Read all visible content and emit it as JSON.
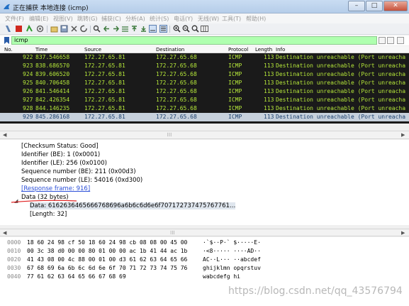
{
  "window": {
    "title": "正在捕获 本地连接 (icmp)",
    "buttons": {
      "minimize": "–",
      "maximize": "□",
      "close": "✕"
    }
  },
  "menu": [
    "文件(F)",
    "编辑(E)",
    "视图(V)",
    "跳转(G)",
    "捕获(C)",
    "分析(A)",
    "统计(S)",
    "电话(Y)",
    "无线(W)",
    "工具(T)",
    "帮助(H)"
  ],
  "filter": {
    "value": "icmp"
  },
  "packet_list": {
    "columns": [
      "No.",
      "Time",
      "Source",
      "Destination",
      "Protocol",
      "Length",
      "Info"
    ],
    "rows": [
      {
        "no": "922",
        "time": "837.546658",
        "src": "172.27.65.81",
        "dst": "172.27.65.68",
        "proto": "ICMP",
        "len": "113",
        "info": "Destination unreachable (Port unreacha"
      },
      {
        "no": "923",
        "time": "838.686570",
        "src": "172.27.65.81",
        "dst": "172.27.65.68",
        "proto": "ICMP",
        "len": "113",
        "info": "Destination unreachable (Port unreacha"
      },
      {
        "no": "924",
        "time": "839.606520",
        "src": "172.27.65.81",
        "dst": "172.27.65.68",
        "proto": "ICMP",
        "len": "113",
        "info": "Destination unreachable (Port unreacha"
      },
      {
        "no": "925",
        "time": "840.706458",
        "src": "172.27.65.81",
        "dst": "172.27.65.68",
        "proto": "ICMP",
        "len": "113",
        "info": "Destination unreachable (Port unreacha"
      },
      {
        "no": "926",
        "time": "841.546414",
        "src": "172.27.65.81",
        "dst": "172.27.65.68",
        "proto": "ICMP",
        "len": "113",
        "info": "Destination unreachable (Port unreacha"
      },
      {
        "no": "927",
        "time": "842.426354",
        "src": "172.27.65.81",
        "dst": "172.27.65.68",
        "proto": "ICMP",
        "len": "113",
        "info": "Destination unreachable (Port unreacha"
      },
      {
        "no": "928",
        "time": "844.146235",
        "src": "172.27.65.81",
        "dst": "172.27.65.68",
        "proto": "ICMP",
        "len": "113",
        "info": "Destination unreachable (Port unreacha"
      },
      {
        "no": "929",
        "time": "845.286168",
        "src": "172.27.65.81",
        "dst": "172.27.65.68",
        "proto": "ICMP",
        "len": "113",
        "info": "Destination unreachable (Port unreacha",
        "selected": true
      }
    ]
  },
  "details": {
    "checksum_status": "[Checksum Status: Good]",
    "id_be": "Identifier (BE): 1 (0x0001)",
    "id_le": "Identifier (LE): 256 (0x0100)",
    "seq_be": "Sequence number (BE): 211 (0x00d3)",
    "seq_le": "Sequence number (LE): 54016 (0xd300)",
    "response_frame": "[Response frame: 916]",
    "data_header": "Data (32 bytes)",
    "data_value": "Data: 6162636465666768696a6b6c6d6e6f707172737475767761…",
    "data_length": "[Length: 32]"
  },
  "bytes": [
    {
      "offset": "0000",
      "hex": "18 60 24 98 cf 50 18 60  24 98 cb 08 08 00 45 00",
      "ascii": "·`$··P·` $·····E·"
    },
    {
      "offset": "0010",
      "hex": "00 3c 38 d0 00 00 80 01  00 00 ac 1b 41 44 ac 1b",
      "ascii": "·<8····· ····AD··"
    },
    {
      "offset": "0020",
      "hex": "41 43 08 00 4c 88 00 01  00 d3 61 62 63 64 65 66",
      "ascii": "AC··L··· ··abcdef"
    },
    {
      "offset": "0030",
      "hex": "67 68 69 6a 6b 6c 6d 6e  6f 70 71 72 73 74 75 76",
      "ascii": "ghijklmn opqrstuv"
    },
    {
      "offset": "0040",
      "hex": "77 61 62 63 64 65 66 67  68 69",
      "ascii": "wabcdefg hi"
    }
  ],
  "watermark": "https://blog.csdn.net/qq_43576794",
  "colors": {
    "packet_fg": "#b6e83a",
    "packet_bg": "#1a1a1a",
    "filter_ok": "#afffaf",
    "link": "#2a4ed8"
  }
}
